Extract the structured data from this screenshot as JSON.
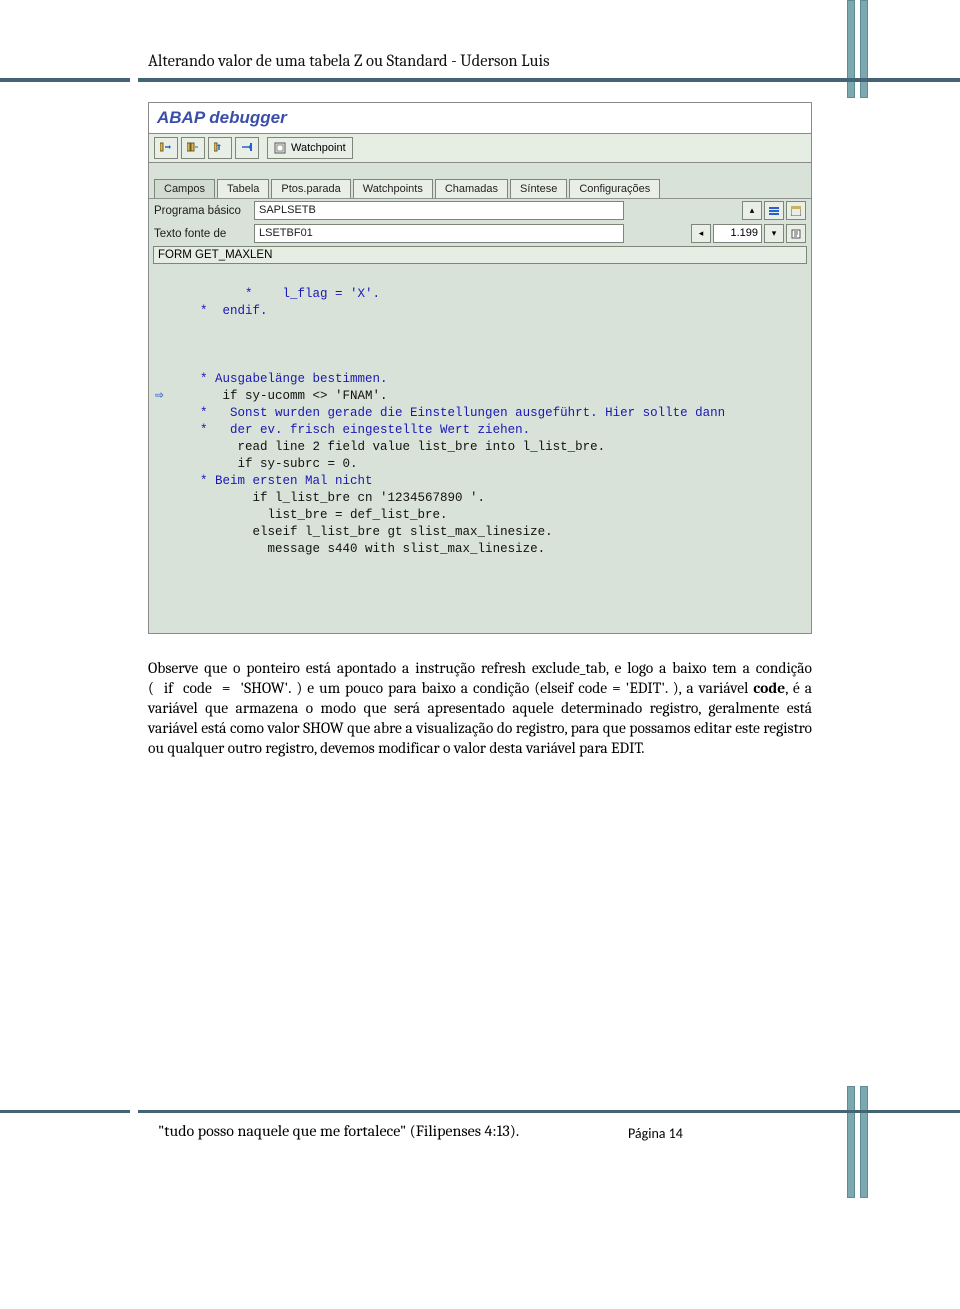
{
  "header": {
    "title": "Alterando valor de uma tabela Z ou Standard - Uderson Luis"
  },
  "sap": {
    "title": "ABAP debugger",
    "toolbar": {
      "watchpoint_label": "Watchpoint"
    },
    "tabs": [
      "Campos",
      "Tabela",
      "Ptos.parada",
      "Watchpoints",
      "Chamadas",
      "Síntese",
      "Configurações"
    ],
    "program": {
      "label": "Programa básico",
      "value": "SAPLSETB"
    },
    "source": {
      "label": "Texto fonte de",
      "value": "LSETBF01"
    },
    "page_indicator": "1.199",
    "form_name": "FORM GET_MAXLEN",
    "code_lines": [
      {
        "gutter": "*",
        "text": "    l_flag = 'X'.",
        "cls": "cmt"
      },
      {
        "gutter": "*",
        "text": "  endif.",
        "cls": "cmt"
      },
      {
        "gutter": "",
        "text": "",
        "cls": ""
      },
      {
        "gutter": "",
        "text": "",
        "cls": ""
      },
      {
        "gutter": "",
        "text": "",
        "cls": ""
      },
      {
        "gutter": "*",
        "text": " Ausgabelänge bestimmen.",
        "cls": "cmt"
      },
      {
        "gutter": "",
        "text": "  if sy-ucomm <> 'FNAM'.",
        "cls": "bk"
      },
      {
        "gutter": "*",
        "text": "   Sonst wurden gerade die Einstellungen ausgeführt. Hier sollte dann",
        "cls": "cmt"
      },
      {
        "gutter": "*",
        "text": "   der ev. frisch eingestellte Wert ziehen.",
        "cls": "cmt"
      },
      {
        "gutter": "",
        "text": "    read line 2 field value list_bre into l_list_bre.",
        "cls": "bk"
      },
      {
        "gutter": "",
        "text": "    if sy-subrc = 0.",
        "cls": "bk"
      },
      {
        "gutter": "*",
        "text": " Beim ersten Mal nicht",
        "cls": "cmt"
      },
      {
        "gutter": "",
        "text": "      if l_list_bre cn '1234567890 '.",
        "cls": "bk"
      },
      {
        "gutter": "",
        "text": "        list_bre = def_list_bre.",
        "cls": "bk"
      },
      {
        "gutter": "",
        "text": "      elseif l_list_bre gt slist_max_linesize.",
        "cls": "bk"
      },
      {
        "gutter": "",
        "text": "        message s440 with slist_max_linesize.",
        "cls": "bk"
      }
    ]
  },
  "body": {
    "paragraph": "Observe que o ponteiro está apontado a instrução refresh exclude_tab, e logo a baixo tem a condição (  if  code   =   'SHOW'.  ) e um pouco para baixo a condição (elseif  code =  'EDIT'. ), a variável code, é a variável que armazena o modo que será apresentado aquele determinado registro, geralmente está variável está como valor SHOW que abre a visualização do registro, para que possamos editar este registro ou qualquer outro registro, devemos modificar o valor desta variável para EDIT."
  },
  "footer": {
    "quote": "\"tudo posso naquele que me fortalece\" (Filipenses 4:13).",
    "page": "Página 14"
  }
}
